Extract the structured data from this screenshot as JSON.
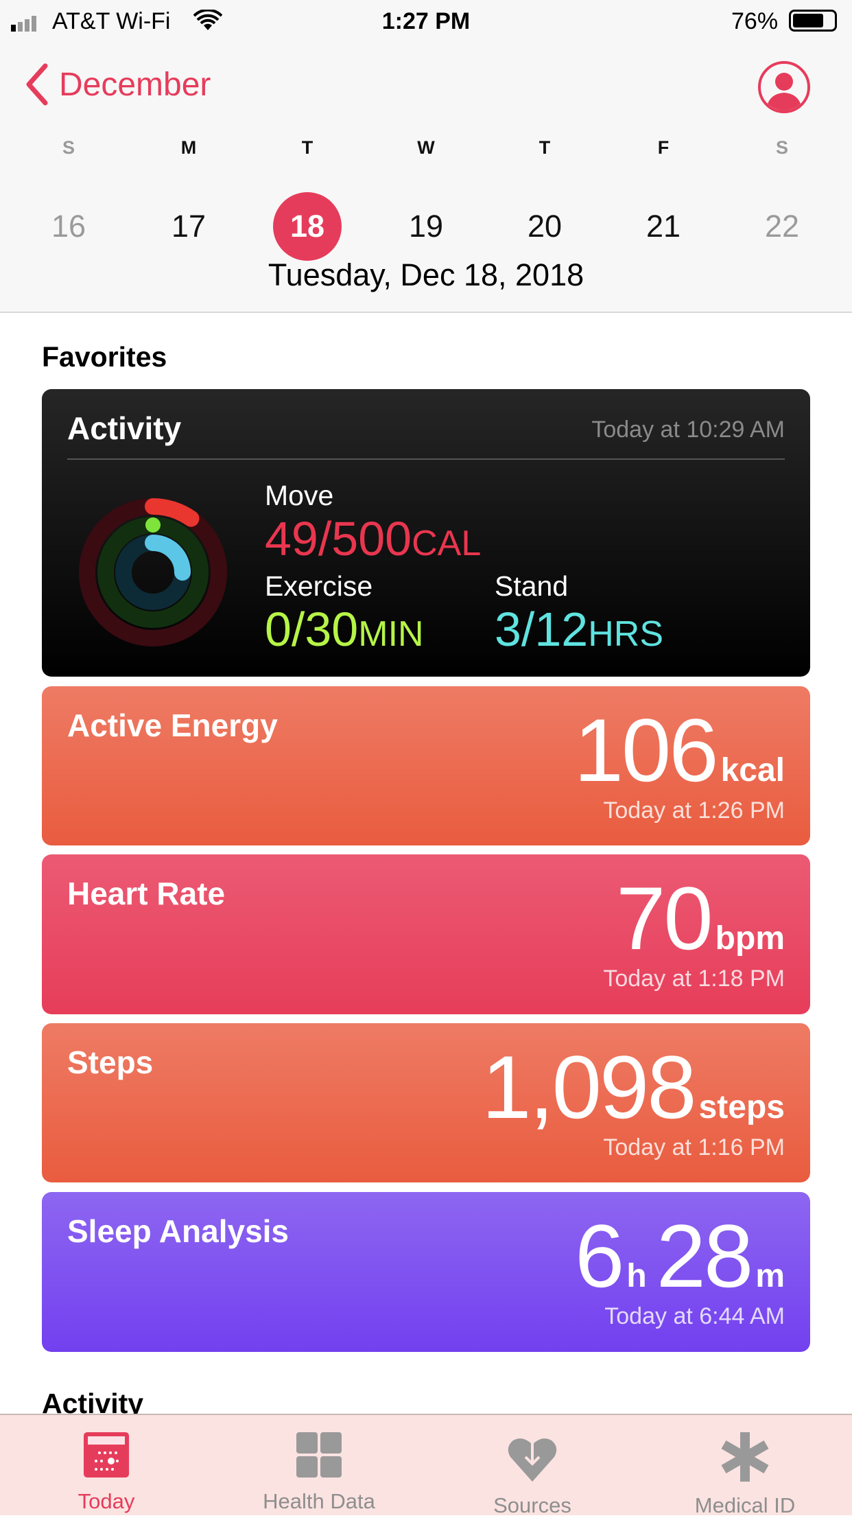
{
  "status_bar": {
    "carrier": "AT&T Wi-Fi",
    "time": "1:27 PM",
    "battery": "76%"
  },
  "nav": {
    "back_label": "December",
    "profile_icon": "person-icon"
  },
  "week": {
    "days": [
      {
        "letter": "S",
        "num": "16"
      },
      {
        "letter": "M",
        "num": "17"
      },
      {
        "letter": "T",
        "num": "18",
        "selected": true
      },
      {
        "letter": "W",
        "num": "19"
      },
      {
        "letter": "T",
        "num": "20"
      },
      {
        "letter": "F",
        "num": "21"
      },
      {
        "letter": "S",
        "num": "22"
      }
    ],
    "selected_date": "Tuesday, Dec 18, 2018"
  },
  "favorites": {
    "title": "Favorites",
    "activity": {
      "title": "Activity",
      "time": "Today at 10:29 AM",
      "move": {
        "label": "Move",
        "value": "49/500",
        "unit": "CAL",
        "progress": 0.098
      },
      "exercise": {
        "label": "Exercise",
        "value": "0/30",
        "unit": "MIN",
        "progress": 0
      },
      "stand": {
        "label": "Stand",
        "value": "3/12",
        "unit": "HRS",
        "progress": 0.25
      }
    },
    "cards": [
      {
        "title": "Active Energy",
        "value": "106",
        "unit": "kcal",
        "time": "Today at 1:26 PM"
      },
      {
        "title": "Heart Rate",
        "value": "70",
        "unit": "bpm",
        "time": "Today at 1:18 PM"
      },
      {
        "title": "Steps",
        "value": "1,098",
        "unit": "steps",
        "time": "Today at 1:16 PM"
      },
      {
        "title": "Sleep Analysis",
        "value_h": "6",
        "unit_h": "h",
        "value_m": "28",
        "unit_m": "m",
        "time": "Today at 6:44 AM"
      }
    ]
  },
  "next_section": "Activity",
  "tabs": [
    {
      "label": "Today",
      "active": true
    },
    {
      "label": "Health Data"
    },
    {
      "label": "Sources"
    },
    {
      "label": "Medical ID"
    }
  ],
  "colors": {
    "accent": "#e63c5b",
    "move": "#e9364f",
    "exercise": "#b6f447",
    "stand": "#5fe3e0"
  }
}
